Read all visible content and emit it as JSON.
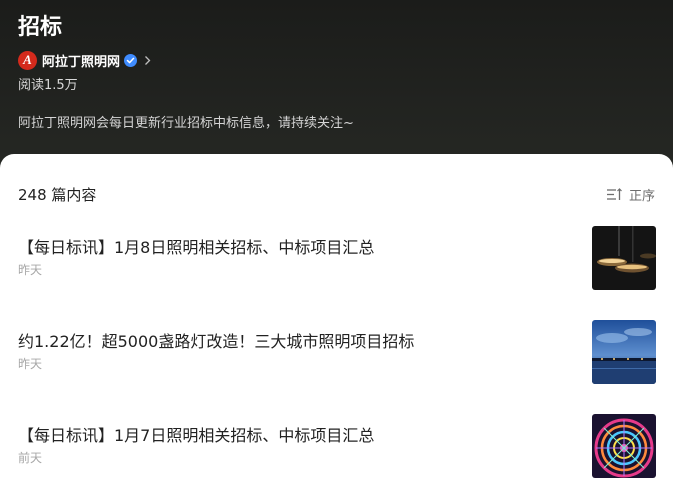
{
  "header": {
    "title": "招标",
    "account_logo_letter": "A",
    "account_name": "阿拉丁照明网",
    "reads": "阅读1.5万",
    "description": "阿拉丁照明网会每日更新行业招标中标信息，请持续关注~"
  },
  "content": {
    "count_label": "248 篇内容",
    "sort_label": "正序",
    "articles": [
      {
        "title": "【每日标讯】1月8日照明相关招标、中标项目汇总",
        "time": "昨天"
      },
      {
        "title": "约1.22亿！超5000盏路灯改造！三大城市照明项目招标",
        "time": "昨天"
      },
      {
        "title": "【每日标讯】1月7日照明相关招标、中标项目汇总",
        "time": "前天"
      }
    ]
  },
  "colors": {
    "header_bg": "#1f211e",
    "verified": "#3f8cff",
    "logo": "#d42a1c"
  }
}
